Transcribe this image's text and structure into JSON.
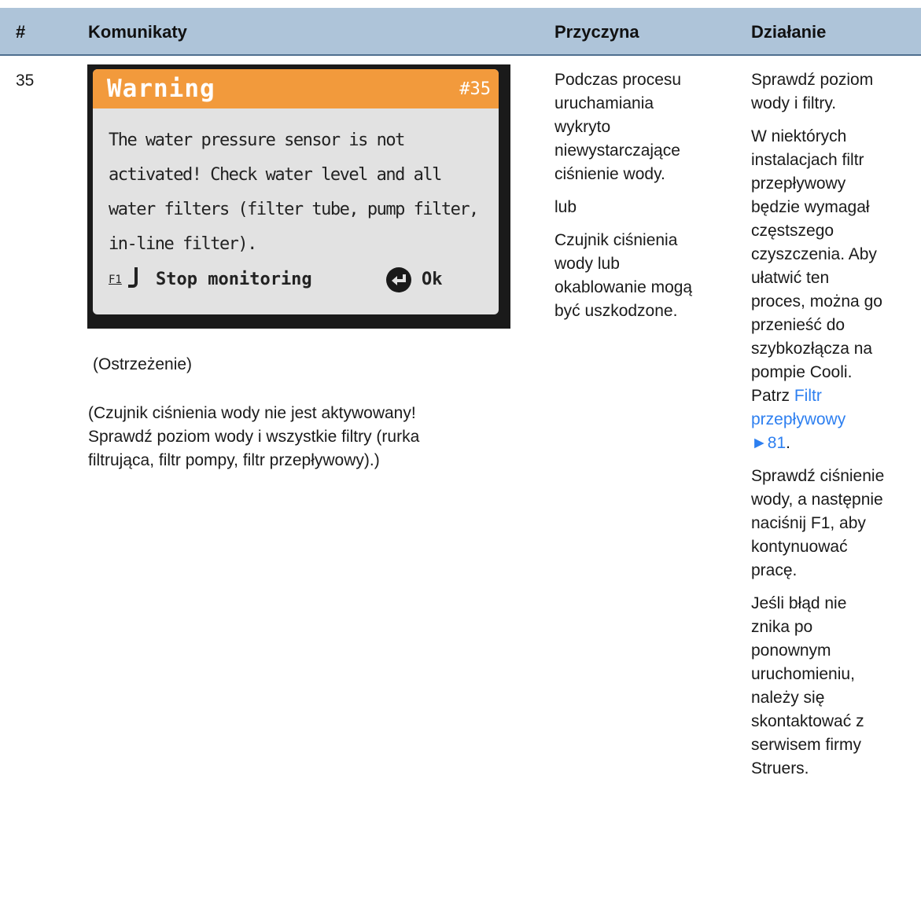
{
  "header": {
    "num": "#",
    "messages": "Komunikaty",
    "cause": "Przyczyna",
    "action": "Działanie",
    "bg_color": "#aec4d9"
  },
  "row": {
    "number": "35",
    "screen": {
      "title": "Warning",
      "code": "#35",
      "lines": [
        "The water pressure sensor is not",
        "activated! Check water level and all",
        "water filters (filter tube, pump filter,",
        "in-line filter)."
      ],
      "f1_key": "F1",
      "stop_label": "Stop monitoring",
      "ok_label": "Ok",
      "title_bar_color": "#f29a3c"
    },
    "caption": "(Ostrzeżenie)",
    "translation_lines": [
      "(Czujnik ciśnienia wody nie jest aktywowany!",
      "Sprawdź poziom wody i wszystkie filtry (rurka",
      "filtrująca, filtr pompy, filtr przepływowy).)"
    ],
    "cause_p1": [
      "Podczas procesu",
      "uruchamiania",
      "wykryto",
      "niewystarczające",
      "ciśnienie wody."
    ],
    "cause_p2": "lub",
    "cause_p3": [
      "Czujnik ciśnienia",
      "wody lub",
      "okablowanie mogą",
      "być uszkodzone."
    ],
    "action_p1": [
      "Sprawdź poziom",
      "wody i filtry."
    ],
    "action_p2": [
      "W niektórych",
      "instalacjach filtr",
      "przepływowy",
      "będzie wymagał",
      "częstszego",
      "czyszczenia. Aby",
      "ułatwić ten",
      "proces, można go",
      "przenieść do",
      "szybkozłącza na",
      "pompie Cooli."
    ],
    "action_see_prefix": "Patrz",
    "action_link_1": "Filtr",
    "action_link_2": "przepływowy",
    "action_link_3": "►81",
    "action_link_end": ".",
    "action_p3": [
      "Sprawdź ciśnienie",
      "wody, a następnie",
      "naciśnij F1, aby",
      "kontynuować",
      "pracę."
    ],
    "action_p4": [
      "Jeśli błąd nie",
      "znika po",
      "ponownym",
      "uruchomieniu,",
      "należy się",
      "skontaktować z",
      "serwisem firmy",
      "Struers."
    ],
    "link_color": "#2d7ff0"
  }
}
